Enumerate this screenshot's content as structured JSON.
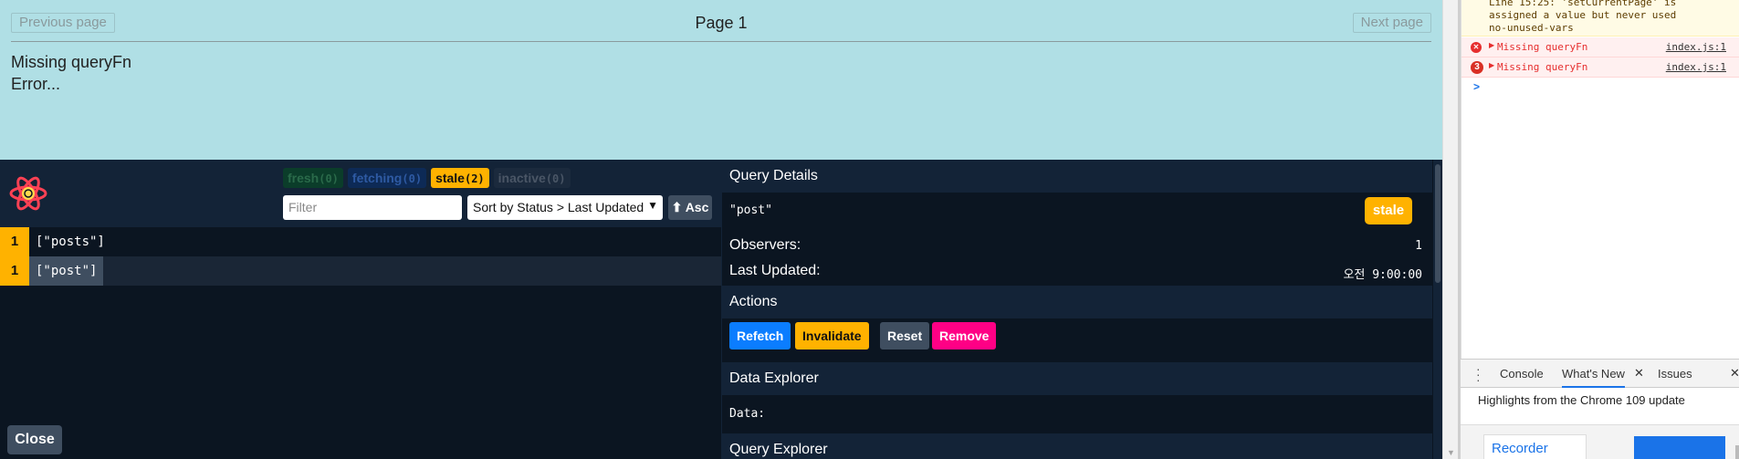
{
  "app": {
    "prev_label": "Previous page",
    "page_label": "Page 1",
    "next_label": "Next page",
    "message_1": "Missing queryFn",
    "message_2": "Error..."
  },
  "devtools": {
    "badges": [
      {
        "label": "fresh",
        "count": "(0)"
      },
      {
        "label": "fetching",
        "count": "(0)"
      },
      {
        "label": "stale",
        "count": "(2)"
      },
      {
        "label": "inactive",
        "count": "(0)"
      }
    ],
    "filter_placeholder": "Filter",
    "sort_value": "Sort by Status > Last Updated",
    "asc_label": "⬆ Asc",
    "queries": [
      {
        "count": "1",
        "key": "[\"posts\"]"
      },
      {
        "count": "1",
        "key": "[\"post\"]"
      }
    ],
    "close_label": "Close",
    "details": {
      "title": "Query Details",
      "query_key": "\"post\"",
      "status": "stale",
      "observers_label": "Observers:",
      "observers_value": "1",
      "last_updated_label": "Last Updated:",
      "last_updated_value": "오전 9:00:00"
    },
    "actions": {
      "title": "Actions",
      "refetch": "Refetch",
      "invalidate": "Invalidate",
      "reset": "Reset",
      "remove": "Remove"
    },
    "data_explorer": {
      "title": "Data Explorer",
      "data_label": "Data:"
    },
    "query_explorer_title": "Query Explorer"
  },
  "console": {
    "warning_text": "Line 15:25: 'setCurrentPage' is assigned a value but never used  no-unused-vars",
    "errors": [
      {
        "count": "",
        "message": "Missing queryFn",
        "source": "index.js:1"
      },
      {
        "count": "3",
        "message": "Missing queryFn",
        "source": "index.js:1"
      }
    ],
    "prompt": ">",
    "drawer_tabs": [
      "Console",
      "What's New",
      "Issues"
    ],
    "active_tab": "What's New",
    "highlights": "Highlights from the Chrome 109 update",
    "recorder_label": "Recorder"
  },
  "colors": {
    "app_bg": "#b0dfe5",
    "devtools_bg": "#0b1521",
    "stale": "#ffb200",
    "refetch": "#0b7dff",
    "remove": "#ff0085",
    "error": "#e62e2e"
  }
}
